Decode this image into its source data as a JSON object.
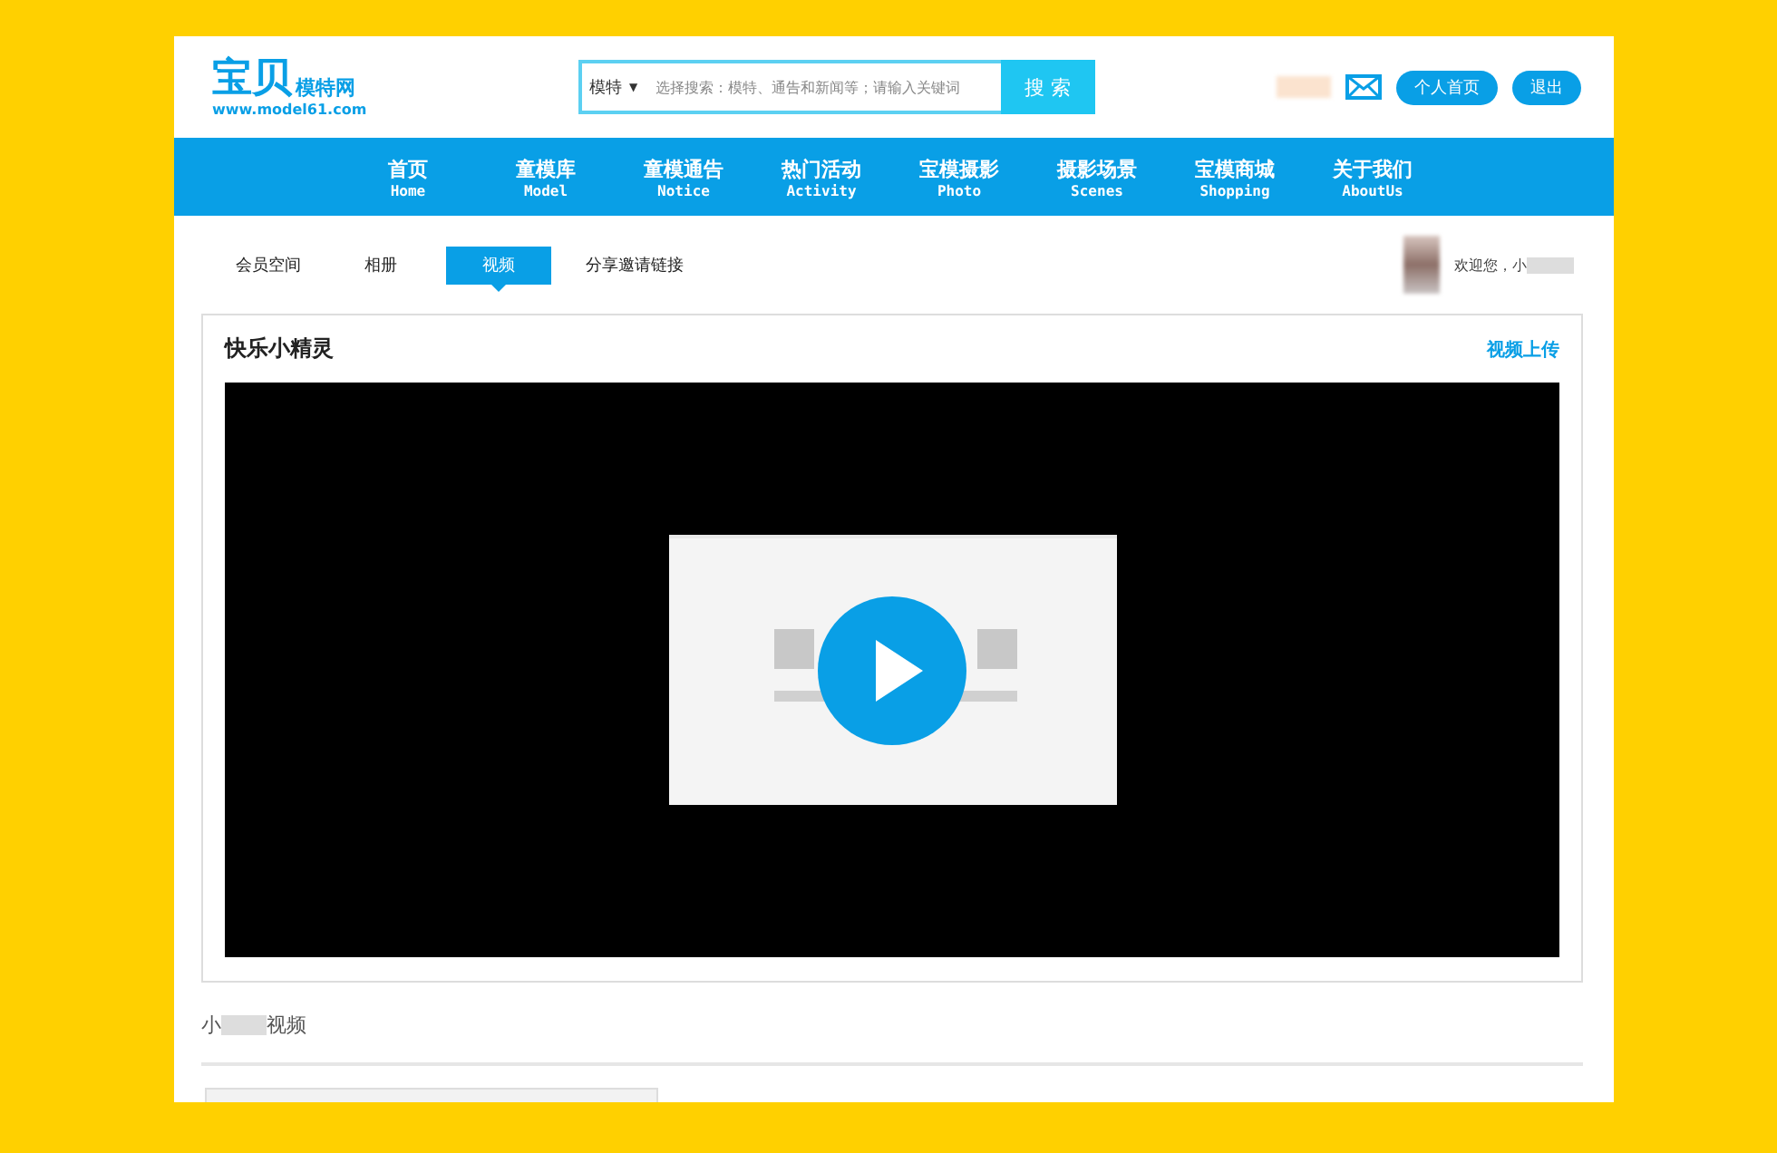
{
  "logo": {
    "title_a": "宝贝",
    "title_b": "模特网",
    "url": "www.model61.com"
  },
  "search": {
    "category": "模特",
    "caret": "▼",
    "placeholder": "选择搜索：模特、通告和新闻等；请输入关键词",
    "button": "搜 索"
  },
  "user_links": [
    "个人首页",
    "退出"
  ],
  "nav": [
    {
      "label": "首页",
      "sub": "Home"
    },
    {
      "label": "童模库",
      "sub": "Model"
    },
    {
      "label": "童模通告",
      "sub": "Notice"
    },
    {
      "label": "热门活动",
      "sub": "Activity"
    },
    {
      "label": "宝模摄影",
      "sub": "Photo"
    },
    {
      "label": "摄影场景",
      "sub": "Scenes"
    },
    {
      "label": "宝模商城",
      "sub": "Shopping"
    },
    {
      "label": "关于我们",
      "sub": "AboutUs"
    }
  ],
  "tabs": [
    {
      "label": "会员空间",
      "selected": false
    },
    {
      "label": "相册",
      "selected": false
    },
    {
      "label": "视频",
      "selected": true
    },
    {
      "label": "分享邀请链接",
      "selected": false
    }
  ],
  "welcome": "欢迎您，小",
  "panel": {
    "title": "快乐小精灵",
    "upload": "视频上传"
  },
  "section": {
    "title_a": "小",
    "title_b": "视频"
  }
}
